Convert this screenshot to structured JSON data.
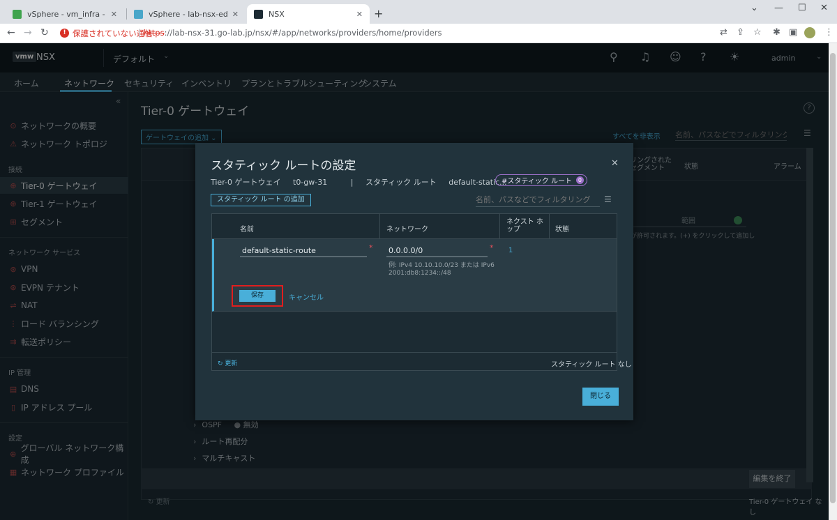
{
  "browser": {
    "tabs": [
      {
        "title": "vSphere - vm_infra - サマリ",
        "active": false
      },
      {
        "title": "vSphere - lab-nsx-edge-31 - サマリ",
        "active": false
      },
      {
        "title": "NSX",
        "active": true
      }
    ],
    "new_tab": "+",
    "security_warning": "保護されていない通信",
    "url_scheme": "https",
    "url_rest": "://lab-nsx-31.go-lab.jp/nsx/#/app/networks/providers/home/providers"
  },
  "header": {
    "logo": "vmw",
    "product": "NSX",
    "project": "デフォルト",
    "user": "admin"
  },
  "nav": {
    "tabs": [
      "ホーム",
      "ネットワーク",
      "セキュリティ",
      "インベントリ",
      "プランとトラブルシューティング",
      "システム"
    ],
    "active": "ネットワーク"
  },
  "sidebar": {
    "items": [
      {
        "label": "ネットワークの概要",
        "icon": "⊙"
      },
      {
        "label": "ネットワーク トポロジ",
        "icon": "⚠"
      }
    ],
    "sections": [
      {
        "title": "接続",
        "items": [
          "Tier-0 ゲートウェイ",
          "Tier-1 ゲートウェイ",
          "セグメント"
        ]
      },
      {
        "title": "ネットワーク サービス",
        "items": [
          "VPN",
          "EVPN テナント",
          "NAT",
          "ロード バランシング",
          "転送ポリシー"
        ]
      },
      {
        "title": "IP 管理",
        "items": [
          "DNS",
          "IP アドレス プール"
        ]
      },
      {
        "title": "設定",
        "items": [
          "グローバル ネットワーク構成",
          "ネットワーク プロファイル"
        ]
      }
    ],
    "active_item": "Tier-0 ゲートウェイ"
  },
  "main": {
    "title": "Tier-0 ゲートウェイ",
    "add_gateway": "ゲートウェイの追加",
    "show_all": "すべてを非表示",
    "filter_placeholder": "名前、パスなどでフィルタリング",
    "columns": [
      "リングされたセグメント",
      "状態",
      "アラーム"
    ],
    "rows": [
      "OSPF",
      "ルート再配分",
      "マルチキャスト"
    ],
    "ospf_state": "無効",
    "range_label": "範囲",
    "hint": "が許可されます。(+) をクリックして追加し",
    "end_edit": "編集を終了",
    "refresh": "更新",
    "count": "Tier-0 ゲートウェイ なし"
  },
  "modal": {
    "title": "スタティック ルートの設定",
    "crumbs": [
      "Tier-0 ゲートウェイ",
      "t0-gw-31",
      "|",
      "スタティック ルート",
      "default-static..."
    ],
    "tag": "#スタティック ルート",
    "tag_count": "0",
    "add_route": "スタティック ルート の追加",
    "filter_placeholder": "名前、パスなどでフィルタリング",
    "columns": {
      "name": "名前",
      "network": "ネットワーク",
      "next_hop_line1": "ネクスト ホ",
      "next_hop_line2": "ップ",
      "status": "状態"
    },
    "row": {
      "name_value": "default-static-route",
      "network_value": "0.0.0.0/0",
      "network_hint": "例: IPv4 10.10.10.0/23 または IPv6 2001:db8:1234::/48",
      "next_hop_count": "1"
    },
    "save": "保存",
    "cancel": "キャンセル",
    "refresh": "更新",
    "count": "スタティック ルート なし",
    "close": "閉じる"
  },
  "colors": {
    "accent": "#49afd9",
    "highlight": "#e01e1e",
    "tag": "#9b6fc8"
  }
}
